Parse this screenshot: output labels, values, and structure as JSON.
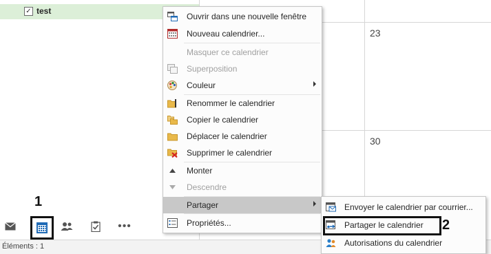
{
  "folder": {
    "name": "test",
    "checked": true
  },
  "nav": {
    "items": [
      {
        "name": "mail",
        "icon": "mail-icon"
      },
      {
        "name": "calendar",
        "icon": "calendar-icon",
        "selected": true
      },
      {
        "name": "people",
        "icon": "people-icon"
      },
      {
        "name": "tasks",
        "icon": "tasks-icon"
      },
      {
        "name": "more",
        "icon": "more-icon",
        "glyph": "•••"
      }
    ]
  },
  "annotations": {
    "step_one": "1",
    "step_two": "2"
  },
  "calendar": {
    "days": [
      "23",
      "30"
    ]
  },
  "status_bar": {
    "text": "Éléments : 1"
  },
  "context_menu": {
    "items": [
      {
        "label": "Ouvrir dans une nouvelle fenêtre",
        "icon": "new-window-icon"
      },
      {
        "label": "Nouveau calendrier...",
        "icon": "new-calendar-icon"
      },
      {
        "label": "Masquer ce calendrier",
        "icon": "hide-calendar-icon",
        "disabled": true
      },
      {
        "label": "Superposition",
        "icon": "overlay-icon",
        "disabled": true
      },
      {
        "label": "Couleur",
        "icon": "color-palette-icon",
        "submenu": true
      },
      {
        "label": "Renommer le calendrier",
        "icon": "rename-folder-icon"
      },
      {
        "label": "Copier le calendrier",
        "icon": "copy-folder-icon"
      },
      {
        "label": "Déplacer le calendrier",
        "icon": "move-folder-icon"
      },
      {
        "label": "Supprimer le calendrier",
        "icon": "delete-folder-icon"
      },
      {
        "label": "Monter",
        "icon": "move-up-icon"
      },
      {
        "label": "Descendre",
        "icon": "move-down-icon",
        "disabled": true
      },
      {
        "label": "Partager",
        "icon": "",
        "submenu": true,
        "highlighted": true
      },
      {
        "label": "Propriétés...",
        "icon": "properties-icon"
      }
    ]
  },
  "share_submenu": {
    "items": [
      {
        "label": "Envoyer le calendrier par courrier...",
        "icon": "email-calendar-icon"
      },
      {
        "label": "Partager le calendrier",
        "icon": "share-calendar-icon"
      },
      {
        "label": "Autorisations du calendrier",
        "icon": "permissions-icon"
      }
    ]
  },
  "colors": {
    "folder_row_bg": "#dcefd8",
    "menu_highlight": "#c8c8c8",
    "disabled_text": "#a0a0a0",
    "calendar_blue": "#1f6ab5"
  }
}
